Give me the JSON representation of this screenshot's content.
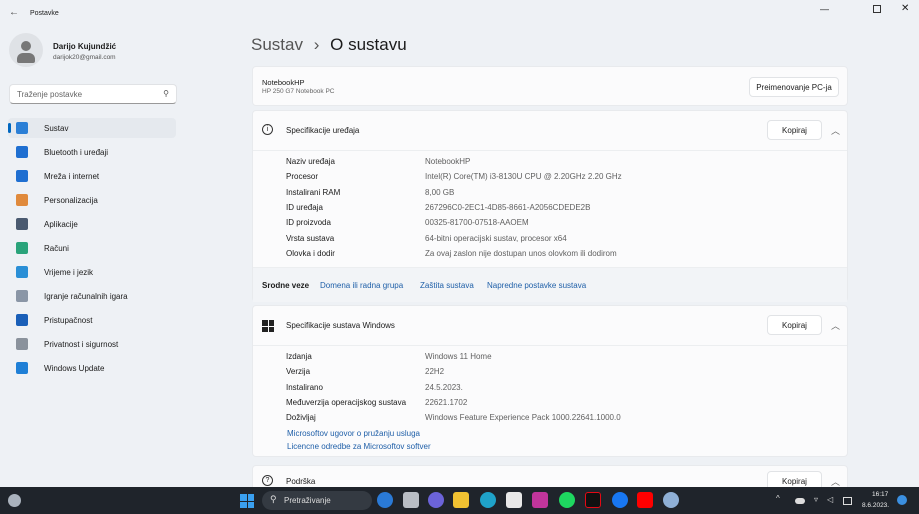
{
  "window": {
    "title": "Postavke"
  },
  "user": {
    "name": "Darijo Kujundžić",
    "email": "darijok20@gmail.com"
  },
  "search": {
    "placeholder": "Traženje postavke"
  },
  "sidebar": {
    "items": [
      {
        "label": "Sustav",
        "color": "#2b7fd6"
      },
      {
        "label": "Bluetooth i uređaji",
        "color": "#1f6fd1"
      },
      {
        "label": "Mreža i internet",
        "color": "#1f6fd1"
      },
      {
        "label": "Personalizacija",
        "color": "#e08a3c"
      },
      {
        "label": "Aplikacije",
        "color": "#4a5a70"
      },
      {
        "label": "Računi",
        "color": "#2aa37a"
      },
      {
        "label": "Vrijeme i jezik",
        "color": "#2a8fd6"
      },
      {
        "label": "Igranje računalnih igara",
        "color": "#8a96a6"
      },
      {
        "label": "Pristupačnost",
        "color": "#1a5fb8"
      },
      {
        "label": "Privatnost i sigurnost",
        "color": "#8a929c"
      },
      {
        "label": "Windows Update",
        "color": "#1f7fd6"
      }
    ]
  },
  "breadcrumb": {
    "parent": "Sustav",
    "separator": "›",
    "current": "O sustavu"
  },
  "pc": {
    "name": "NotebookHP",
    "model": "HP 250 G7 Notebook PC",
    "rename_label": "Preimenovanje PC-ja"
  },
  "device_specs": {
    "title": "Specifikacije uređaja",
    "copy_label": "Kopiraj",
    "rows": [
      {
        "label": "Naziv uređaja",
        "value": "NotebookHP"
      },
      {
        "label": "Procesor",
        "value": "Intel(R) Core(TM) i3-8130U CPU @ 2.20GHz   2.20 GHz"
      },
      {
        "label": "Instalirani RAM",
        "value": "8,00 GB"
      },
      {
        "label": "ID uređaja",
        "value": "267296C0-2EC1-4D85-8661-A2056CDEDE2B"
      },
      {
        "label": "ID proizvoda",
        "value": "00325-81700-07518-AAOEM"
      },
      {
        "label": "Vrsta sustava",
        "value": "64-bitni operacijski sustav, procesor x64"
      },
      {
        "label": "Olovka i dodir",
        "value": "Za ovaj zaslon nije dostupan unos olovkom ili dodirom"
      }
    ]
  },
  "related": {
    "label": "Srodne veze",
    "links": [
      "Domena ili radna grupa",
      "Zaštita sustava",
      "Napredne postavke sustava"
    ]
  },
  "windows_specs": {
    "title": "Specifikacije sustava Windows",
    "copy_label": "Kopiraj",
    "rows": [
      {
        "label": "Izdanja",
        "value": "Windows 11 Home"
      },
      {
        "label": "Verzija",
        "value": "22H2"
      },
      {
        "label": "Instalirano",
        "value": "24.5.2023."
      },
      {
        "label": "Međuverzija operacijskog sustava",
        "value": "22621.1702"
      },
      {
        "label": "Doživljaj",
        "value": "Windows Feature Experience Pack 1000.22641.1000.0"
      }
    ],
    "links": [
      "Microsoftov ugovor o pružanju usluga",
      "Licencne odredbe za Microsoftov softver"
    ]
  },
  "support": {
    "title": "Podrška",
    "copy_label": "Kopiraj"
  },
  "taskbar": {
    "search_label": "Pretraživanje",
    "time": "16:17",
    "date": "8.6.2023."
  }
}
